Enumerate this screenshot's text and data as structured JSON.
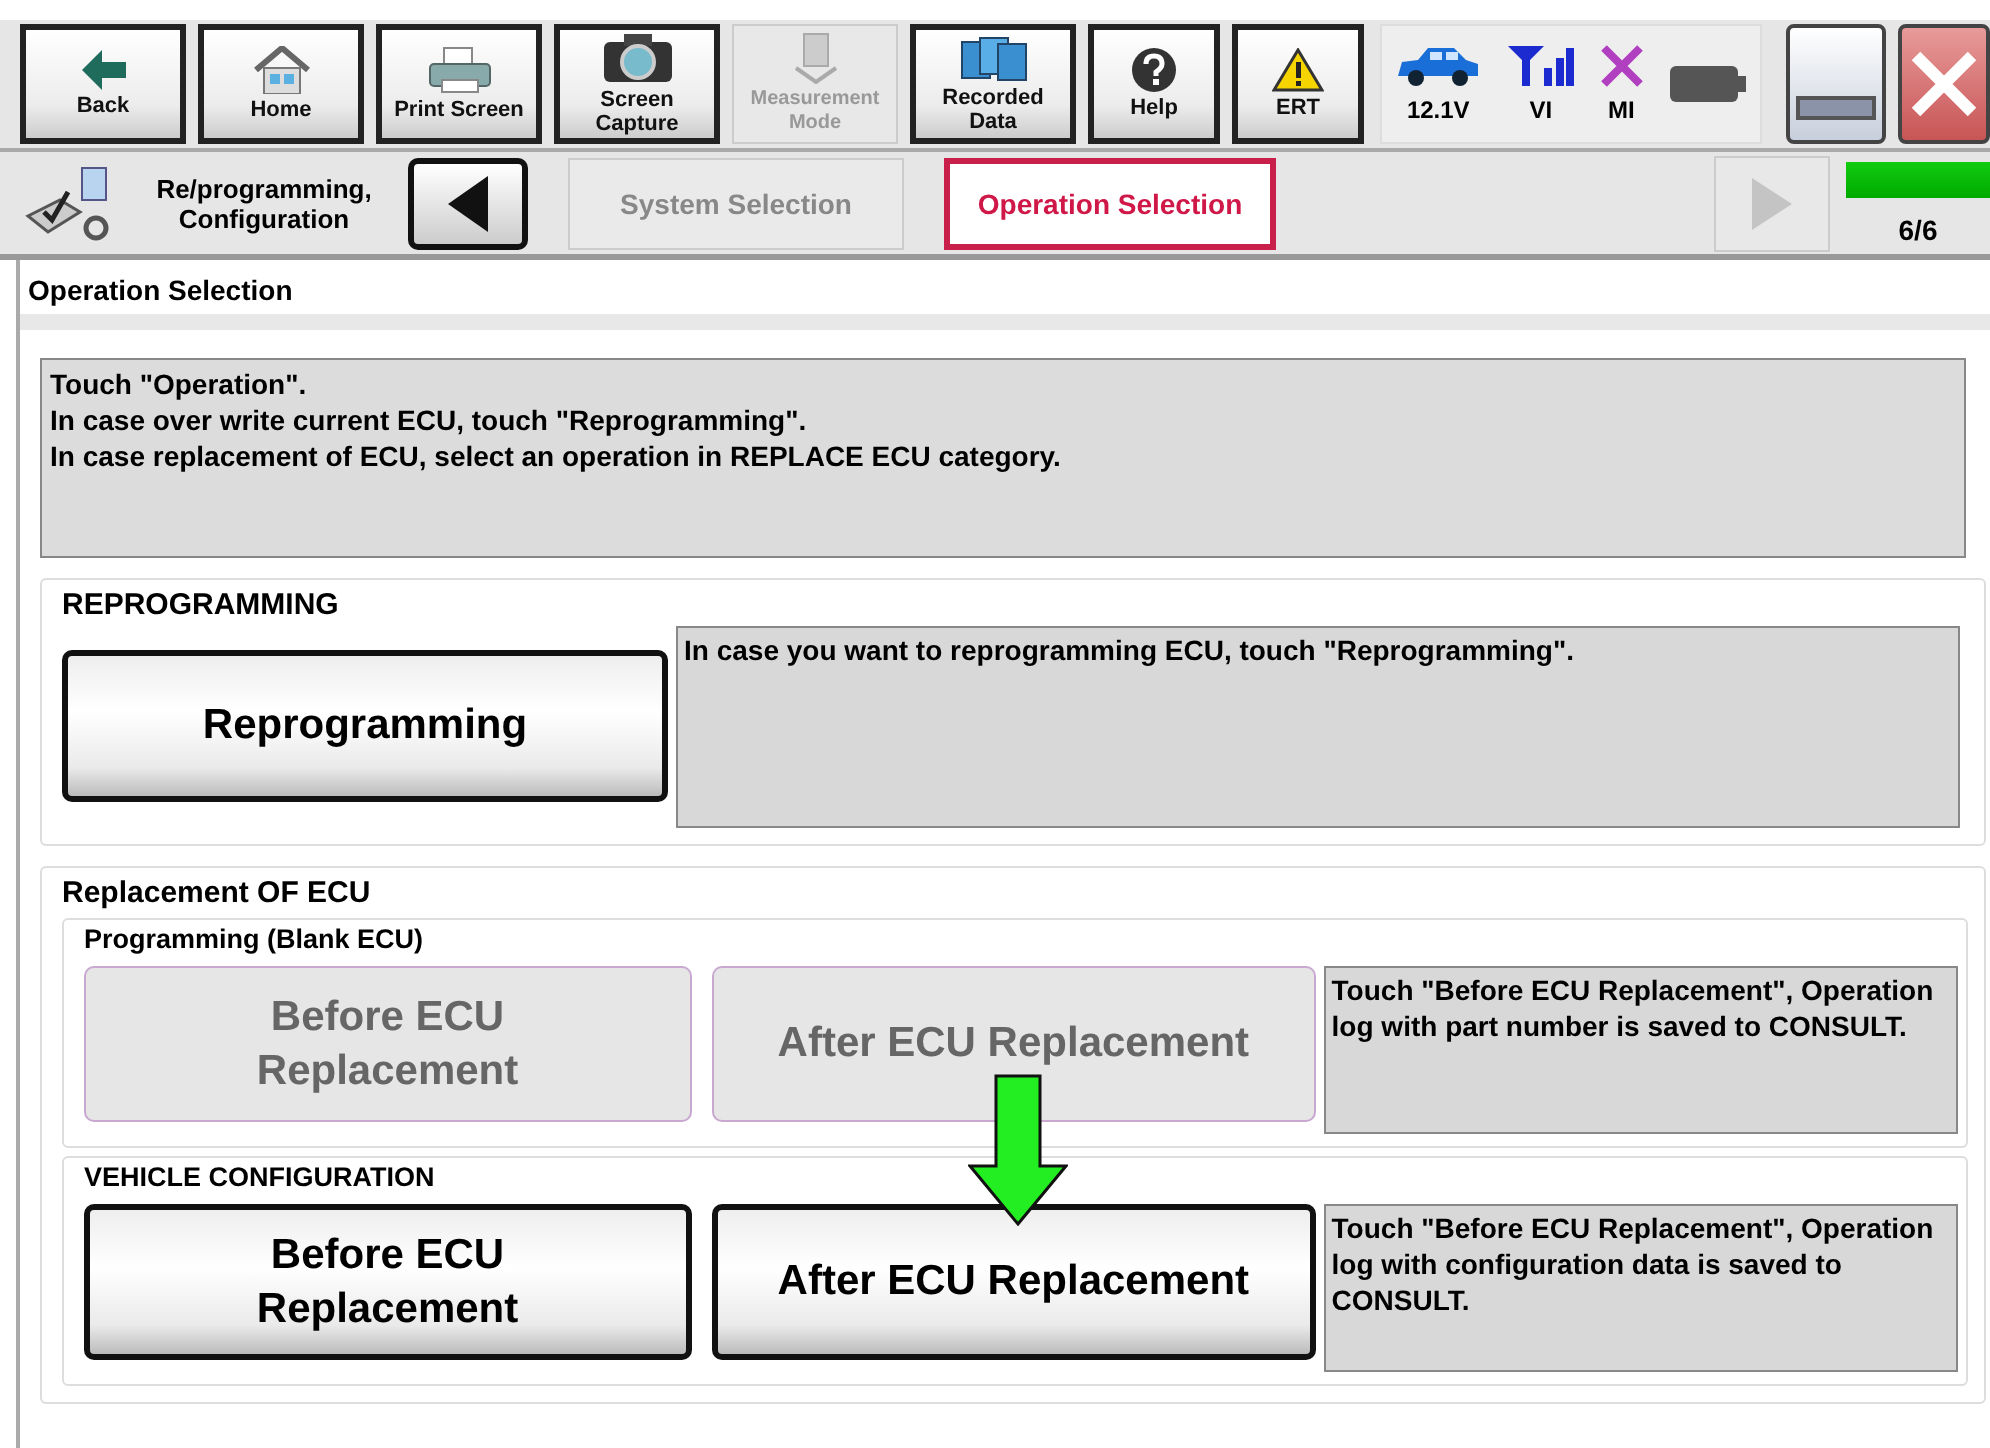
{
  "toolbar": {
    "buttons": [
      {
        "label": "Back",
        "kind": "back",
        "disabled": false
      },
      {
        "label": "Home",
        "kind": "home",
        "disabled": false
      },
      {
        "label": "Print Screen",
        "kind": "print",
        "disabled": false
      },
      {
        "label": "Screen Capture",
        "kind": "camera",
        "disabled": false
      },
      {
        "label": "Measurement Mode",
        "kind": "measure",
        "disabled": true
      },
      {
        "label": "Recorded Data",
        "kind": "folders",
        "disabled": false
      },
      {
        "label": "Help",
        "kind": "help",
        "disabled": false
      },
      {
        "label": "ERT",
        "kind": "warning",
        "disabled": false
      }
    ],
    "status": [
      {
        "label": "12.1V",
        "kind": "car"
      },
      {
        "label": "VI",
        "kind": "signal"
      },
      {
        "label": "MI",
        "kind": "cross"
      },
      {
        "kind": "battery"
      }
    ]
  },
  "breadcrumb": {
    "title": "Re/programming, Configuration",
    "steps": [
      {
        "label": "System Selection",
        "selected": false
      },
      {
        "label": "Operation Selection",
        "selected": true
      }
    ],
    "next_disabled": true,
    "progress": {
      "level": 1,
      "label": "6/6"
    }
  },
  "page_title": "Operation Selection",
  "instructions": [
    "Touch \"Operation\".",
    "In case over write current ECU, touch \"Reprogramming\".",
    "In case replacement of ECU, select an operation in REPLACE ECU category."
  ],
  "reprogramming": {
    "title": "REPROGRAMMING",
    "button": {
      "label": "Reprogramming",
      "disabled": false
    },
    "description": "In case you want to reprogramming ECU, touch \"Reprogramming\"."
  },
  "replacement": {
    "title": "Replacement OF ECU",
    "groups": [
      {
        "title": "Programming (Blank ECU)",
        "buttons": [
          {
            "label": "Before ECU Replacement",
            "disabled": true
          },
          {
            "label": "After ECU Replacement",
            "disabled": true
          }
        ],
        "description": "Touch \"Before ECU Replacement\", Operation log with part number is saved to CONSULT."
      },
      {
        "title": "VEHICLE CONFIGURATION",
        "buttons": [
          {
            "label": "Before ECU Replacement",
            "disabled": false
          },
          {
            "label": "After ECU Replacement",
            "disabled": false
          }
        ],
        "description": "Touch \"Before ECU Replacement\", Operation log with configuration data is saved to CONSULT."
      }
    ]
  }
}
